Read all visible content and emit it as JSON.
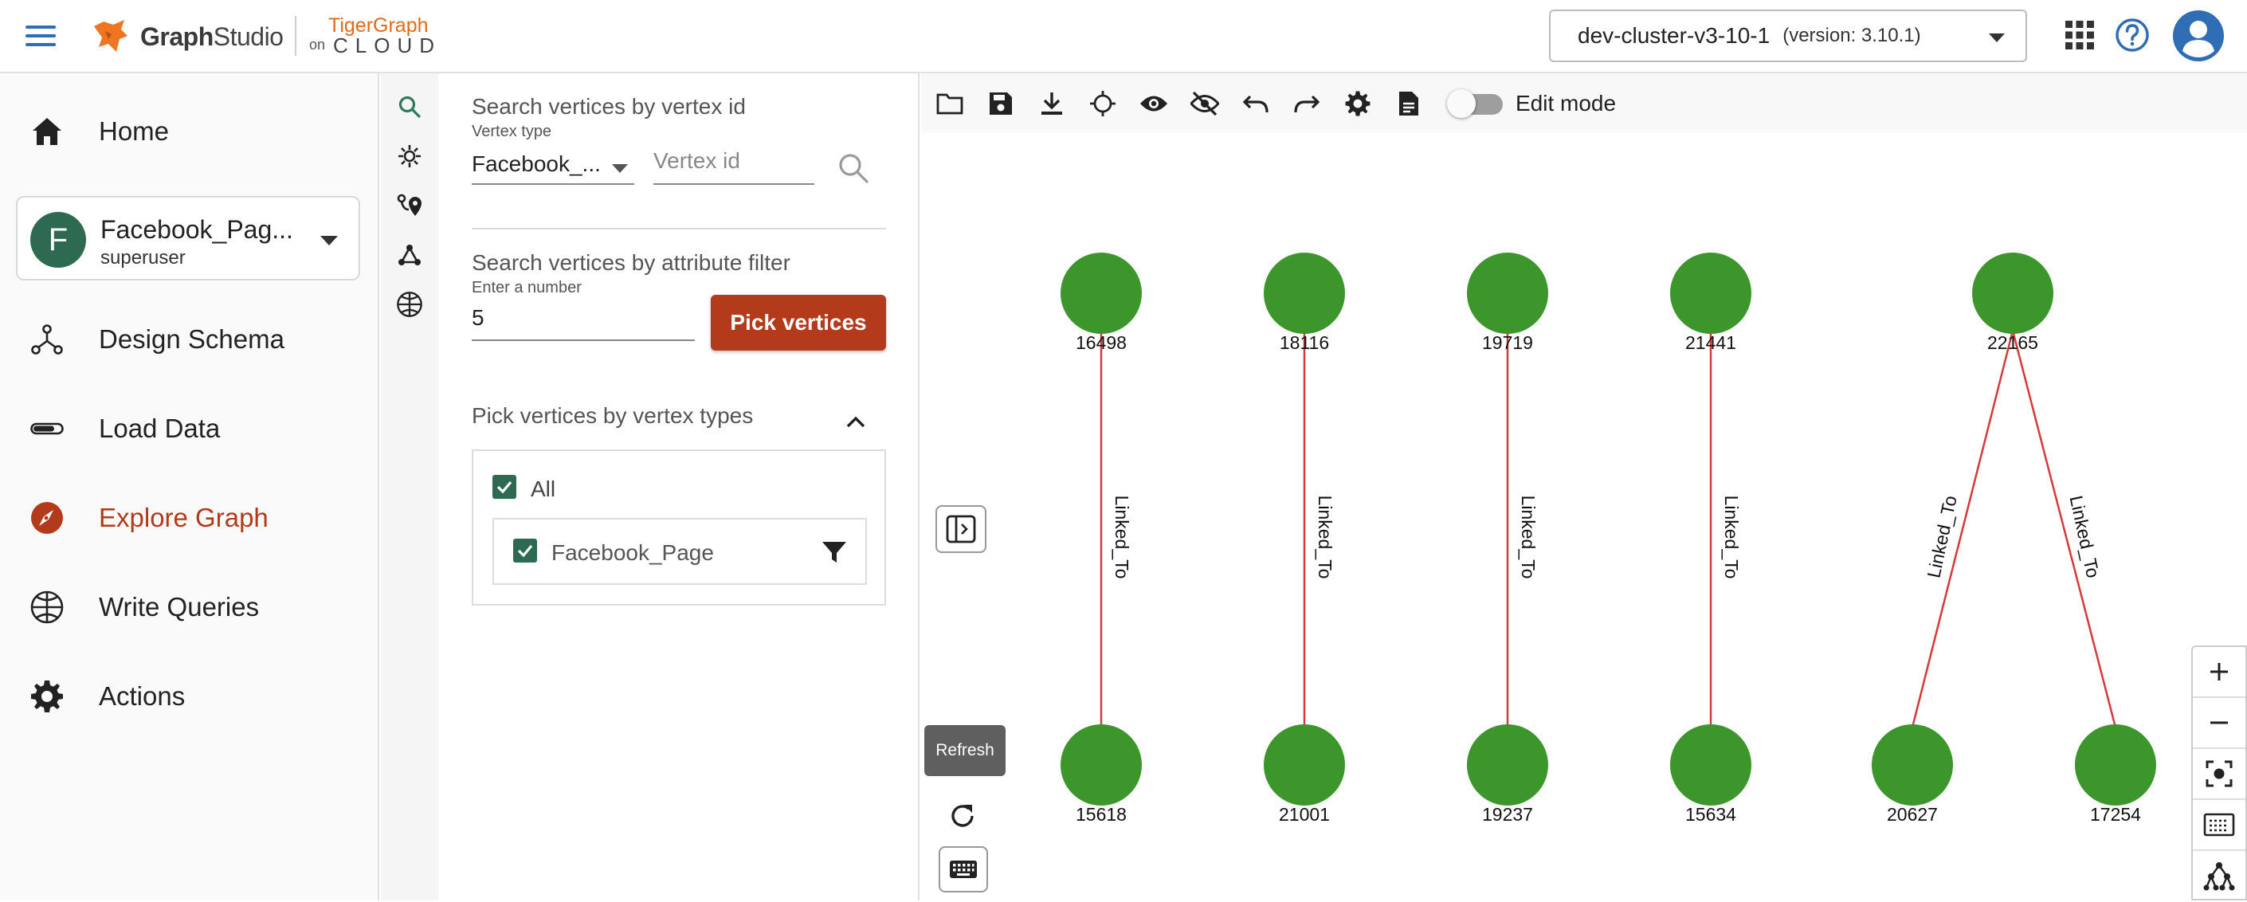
{
  "header": {
    "brand_name_bold": "Graph",
    "brand_name_rest": "Studio",
    "partner_top": "TigerGraph",
    "partner_on": "on",
    "partner_cloud": "CLOUD",
    "cluster": {
      "name": "dev-cluster-v3-10-1",
      "version": "(version: 3.10.1)"
    }
  },
  "nav": {
    "home": "Home",
    "graph": {
      "initial": "F",
      "name": "Facebook_Pag...",
      "role": "superuser"
    },
    "design_schema": "Design Schema",
    "load_data": "Load Data",
    "explore_graph": "Explore Graph",
    "write_queries": "Write Queries",
    "actions": "Actions"
  },
  "panel": {
    "search_by_id_heading": "Search vertices by vertex id",
    "vertex_type_label": "Vertex type",
    "vertex_type_value": "Facebook_...",
    "vertex_id_placeholder": "Vertex id",
    "attr_filter_heading": "Search vertices by attribute filter",
    "number_label": "Enter a number",
    "number_value": "5",
    "pick_button": "Pick vertices",
    "types_heading": "Pick vertices by vertex types",
    "all_label": "All",
    "type_label": "Facebook_Page"
  },
  "toolbar": {
    "edit_mode_label": "Edit mode"
  },
  "canvas": {
    "refresh_tooltip": "Refresh"
  },
  "colors": {
    "vertex": "#3c962c",
    "edge": "#d43a3a",
    "accent": "#b33a1a",
    "avatar": "#2e6a52"
  },
  "graph": {
    "vertices": [
      {
        "id": "16498"
      },
      {
        "id": "18116"
      },
      {
        "id": "19719"
      },
      {
        "id": "21441"
      },
      {
        "id": "22165"
      },
      {
        "id": "15618"
      },
      {
        "id": "21001"
      },
      {
        "id": "19237"
      },
      {
        "id": "15634"
      },
      {
        "id": "20627"
      },
      {
        "id": "17254"
      }
    ],
    "edges": [
      {
        "from": "16498",
        "to": "15618",
        "label": "Linked_To"
      },
      {
        "from": "18116",
        "to": "21001",
        "label": "Linked_To"
      },
      {
        "from": "19719",
        "to": "19237",
        "label": "Linked_To"
      },
      {
        "from": "21441",
        "to": "15634",
        "label": "Linked_To"
      },
      {
        "from": "22165",
        "to": "20627",
        "label": "Linked_To"
      },
      {
        "from": "22165",
        "to": "17254",
        "label": "Linked_To"
      }
    ]
  }
}
